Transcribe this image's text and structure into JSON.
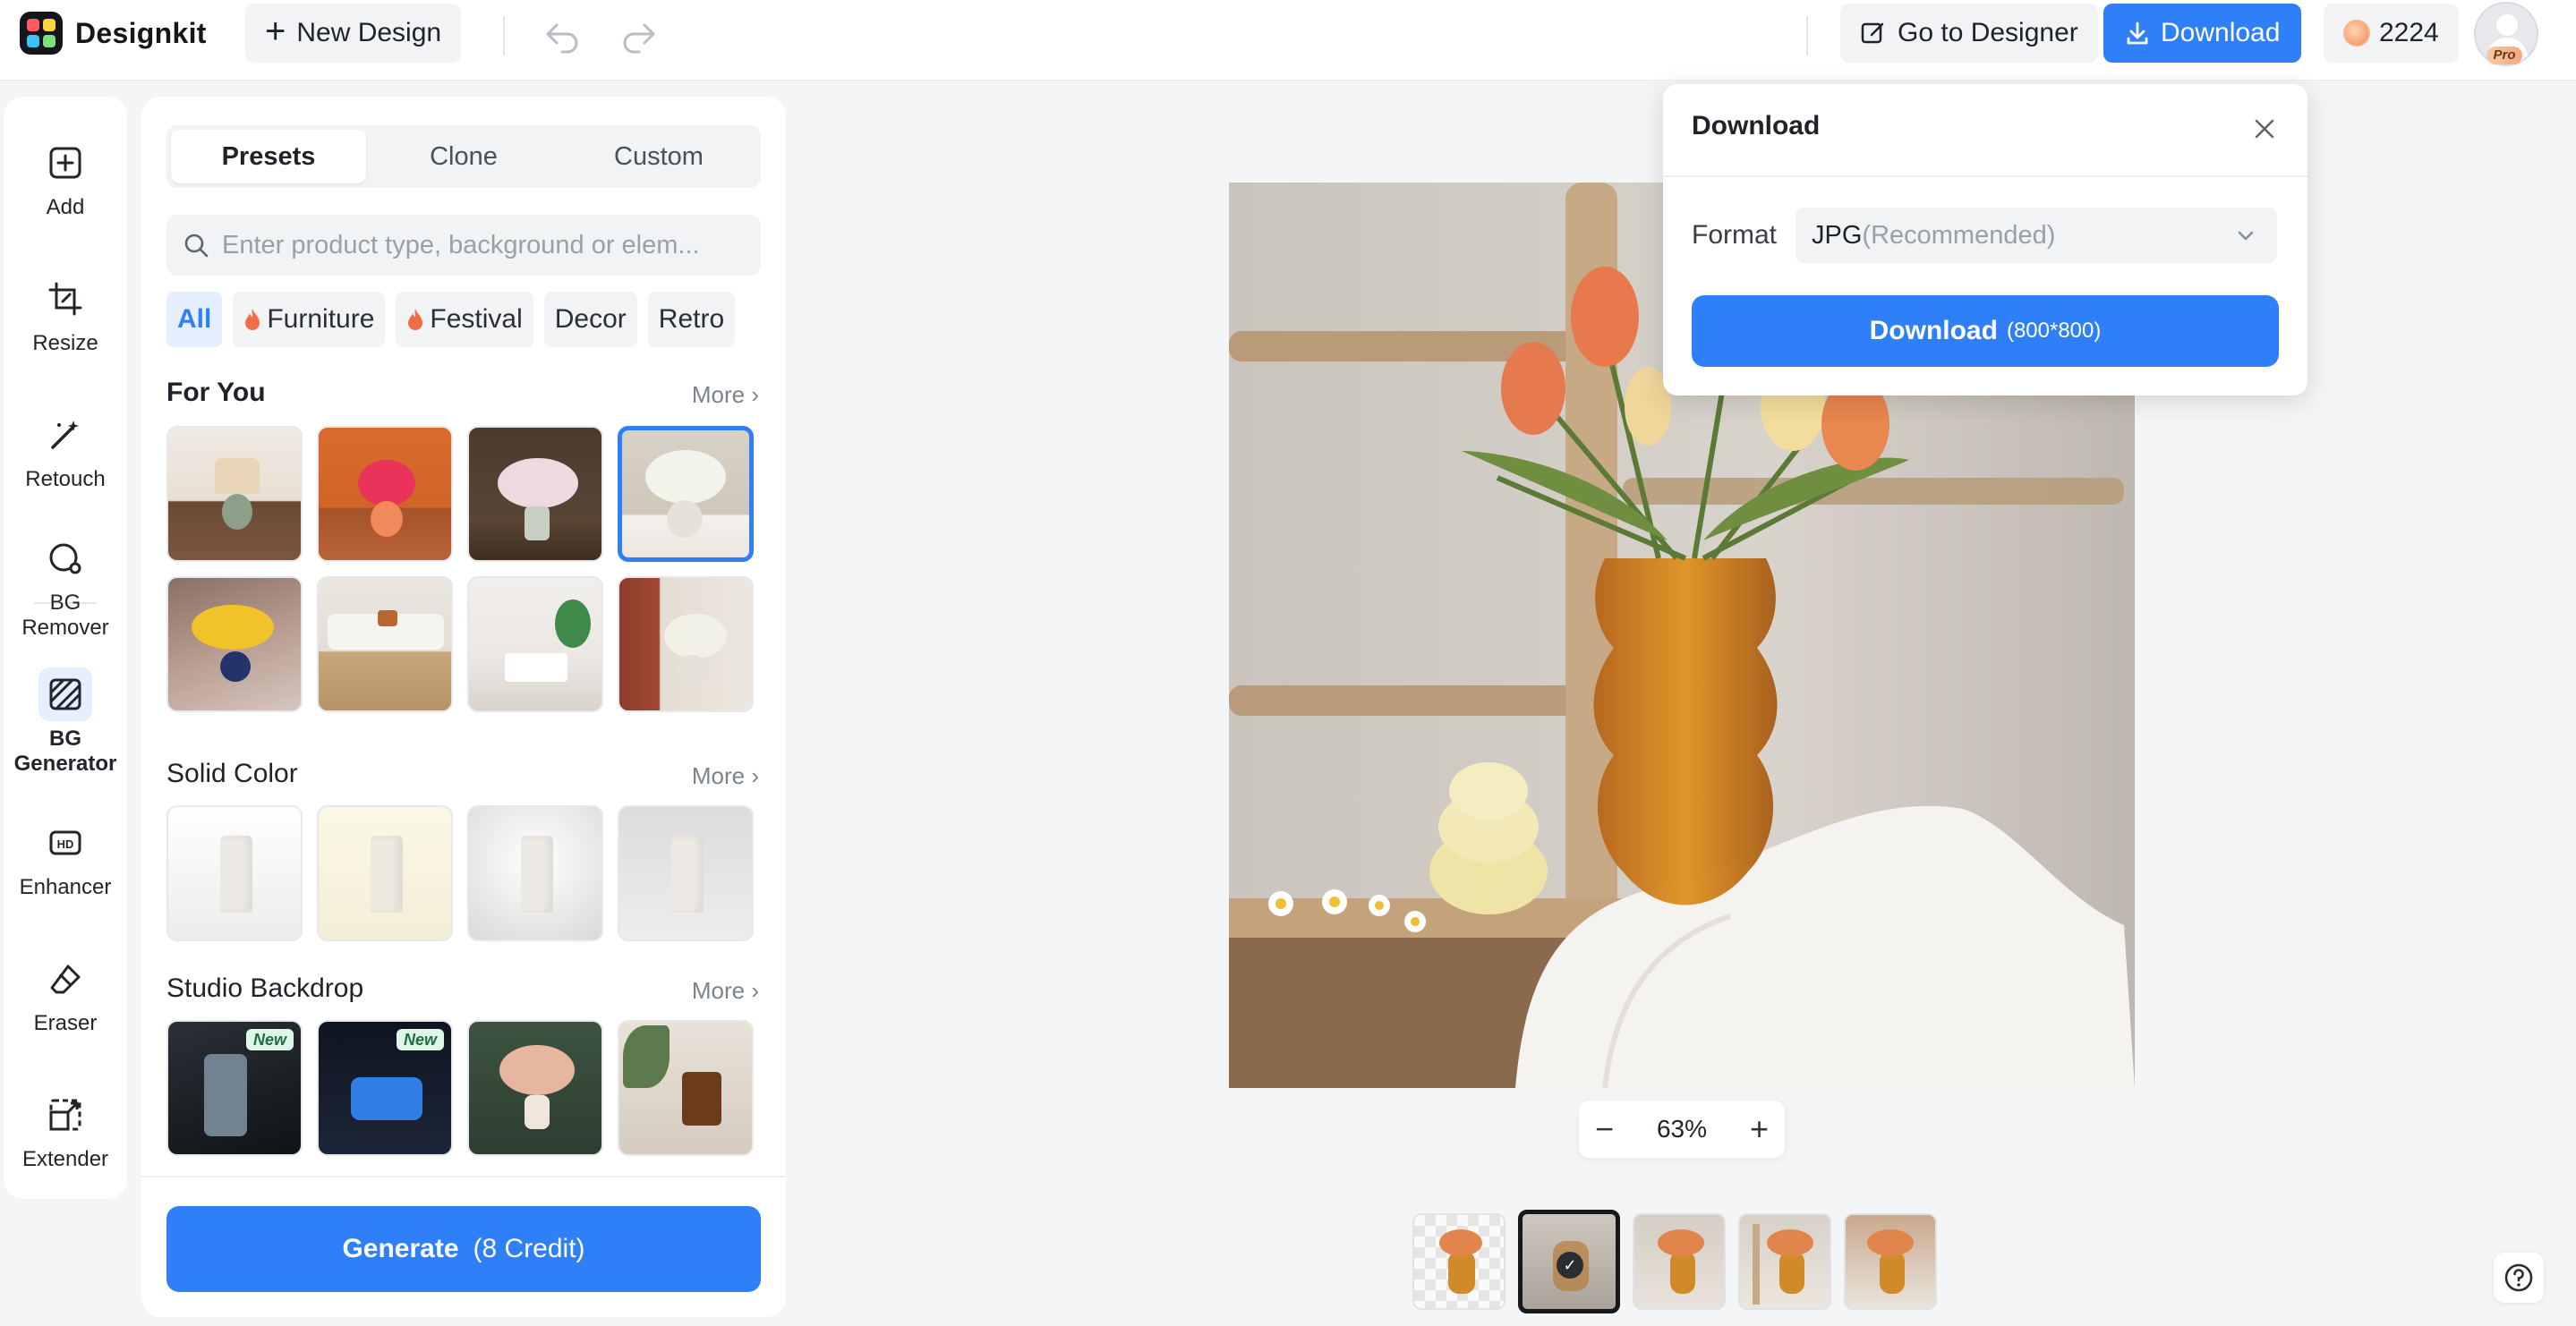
{
  "app": {
    "name": "Designkit"
  },
  "toolbar": {
    "new_design_label": "New Design",
    "go_to_designer_label": "Go to Designer",
    "download_label": "Download",
    "credits": "2224",
    "pro_badge": "Pro"
  },
  "tools": [
    {
      "label": "Add",
      "icon": "add-icon"
    },
    {
      "label": "Resize",
      "icon": "crop-icon"
    },
    {
      "label": "Retouch",
      "icon": "magic-wand-icon"
    },
    {
      "label": "BG\nRemover",
      "icon": "bg-remover-icon"
    },
    {
      "label": "BG\nGenerator",
      "icon": "bg-generator-icon",
      "active": true
    },
    {
      "label": "Enhancer",
      "icon": "hd-icon"
    },
    {
      "label": "Eraser",
      "icon": "eraser-icon"
    },
    {
      "label": "Extender",
      "icon": "extend-icon"
    }
  ],
  "panel": {
    "tabs": [
      "Presets",
      "Clone",
      "Custom"
    ],
    "active_tab": "Presets",
    "search_placeholder": "Enter product type, background or elem...",
    "chips": [
      {
        "label": "All",
        "active": true
      },
      {
        "label": "Furniture",
        "hot": true
      },
      {
        "label": "Festival",
        "hot": true
      },
      {
        "label": "Decor"
      },
      {
        "label": "Retro"
      }
    ],
    "sections": [
      {
        "title": "For You",
        "more": "More"
      },
      {
        "title": "Solid Color",
        "more": "More"
      },
      {
        "title": "Studio Backdrop",
        "more": "More",
        "tags": [
          "New",
          "New"
        ]
      }
    ],
    "generate_label": "Generate",
    "generate_cost": "(8 Credit)"
  },
  "canvas": {
    "zoom": "63%"
  },
  "download_popover": {
    "title": "Download",
    "format_label": "Format",
    "format_value": "JPG",
    "format_hint": "(Recommended)",
    "button_label": "Download",
    "button_size": "(800*800)"
  },
  "colors": {
    "accent": "#2f80f8",
    "background": "#f4f5f7"
  }
}
